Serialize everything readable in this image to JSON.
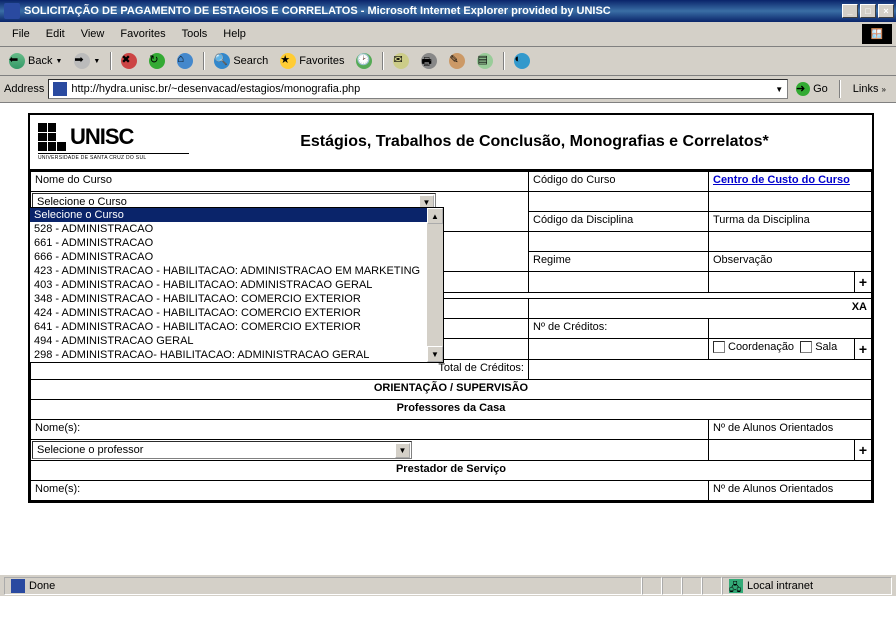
{
  "window": {
    "title": "SOLICITAÇÃO DE PAGAMENTO DE ESTAGIOS E CORRELATOS - Microsoft Internet Explorer provided by UNISC"
  },
  "menu": [
    "File",
    "Edit",
    "View",
    "Favorites",
    "Tools",
    "Help"
  ],
  "toolbar": {
    "back": "Back",
    "search": "Search",
    "favorites": "Favorites"
  },
  "addressbar": {
    "label": "Address",
    "url": "http://hydra.unisc.br/~desenvacad/estagios/monografia.php",
    "go": "Go",
    "links": "Links"
  },
  "page": {
    "logo_text": "UNISC",
    "logo_sub": "UNIVERSIDADE DE SANTA CRUZ DO SUL",
    "title": "Estágios, Trabalhos de Conclusão, Monografias e Correlatos*",
    "nome_curso": "Nome do Curso",
    "codigo_curso": "Código do Curso",
    "centro_custo": "Centro de Custo do Curso",
    "codigo_disc": "Código da Disciplina",
    "turma_disc": "Turma da Disciplina",
    "regime": "Regime",
    "observacao": "Observação",
    "xa": "XA",
    "n_creditos": "Nº de Créditos:",
    "coordenacao": "Coordenação",
    "sala": "Sala",
    "total_creditos": "Total de Créditos:",
    "orient_sup": "ORIENTAÇÃO / SUPERVISÃO",
    "prof_casa": "Professores da Casa",
    "nomes": "Nome(s):",
    "n_alunos": "Nº de Alunos Orientados",
    "prestador": "Prestador de Serviço",
    "sel_curso": "Selecione o Curso",
    "sel_prof": "Selecione o professor"
  },
  "dropdown": {
    "items": [
      "Selecione o Curso",
      "528 - ADMINISTRACAO",
      "661 - ADMINISTRACAO",
      "666 - ADMINISTRACAO",
      "423 - ADMINISTRACAO - HABILITACAO: ADMINISTRACAO EM MARKETING",
      "403 - ADMINISTRACAO - HABILITACAO: ADMINISTRACAO GERAL",
      "348 - ADMINISTRACAO - HABILITACAO: COMERCIO EXTERIOR",
      "424 - ADMINISTRACAO - HABILITACAO: COMERCIO EXTERIOR",
      "641 - ADMINISTRACAO - HABILITACAO: COMERCIO EXTERIOR",
      "494 - ADMINISTRACAO GERAL",
      "298 - ADMINISTRACAO- HABILITACAO: ADMINISTRACAO GERAL"
    ]
  },
  "status": {
    "done": "Done",
    "zone": "Local intranet"
  }
}
